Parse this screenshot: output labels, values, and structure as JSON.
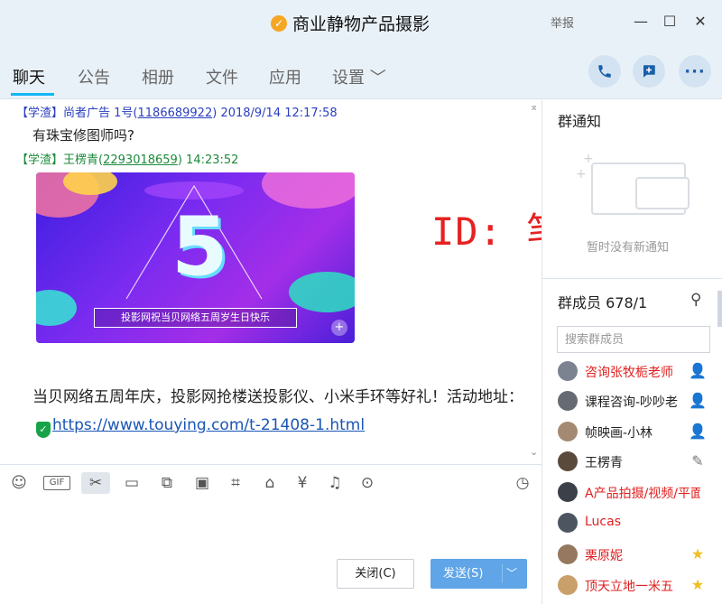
{
  "window": {
    "title": "商业静物产品摄影",
    "report_label": "举报",
    "minimize_icon": "minimize-icon",
    "maximize_icon": "maximize-icon",
    "close_icon": "close-icon"
  },
  "tabs": [
    {
      "label": "聊天"
    },
    {
      "label": "公告"
    },
    {
      "label": "相册"
    },
    {
      "label": "文件"
    },
    {
      "label": "应用"
    },
    {
      "label": "设置 ﹀"
    }
  ],
  "chat": {
    "msg1": {
      "tag": "【学渣】",
      "sender": "尚者广告 1号",
      "qq": "1186689922",
      "time": "2018/9/14 12:17:58",
      "text": "有珠宝修图师吗?"
    },
    "msg2": {
      "tag": "【学渣】",
      "sender": "王楞青",
      "qq": "2293018659",
      "time": "14:23:52"
    },
    "banner_caption": "投影网祝当贝网络五周岁生日快乐",
    "banner_number": "5",
    "body_text": "当贝网络五周年庆，投影网抢楼送投影仪、小米手环等好礼！活动地址：",
    "body_link": "https://www.touying.com/t-21408-1.html",
    "watermark": "ID: 笔中求生"
  },
  "toolbar": {
    "icons": [
      "emoji-icon",
      "gif-icon",
      "scissors-icon",
      "folder-icon",
      "screenshot-icon",
      "image-icon",
      "game-icon",
      "gift-icon",
      "red-packet-icon",
      "bell-icon",
      "more-icon",
      "history-icon"
    ]
  },
  "composer": {
    "close_label": "关闭(C)",
    "send_label": "发送(S)"
  },
  "notice": {
    "title": "群通知",
    "empty_text": "暂时没有新通知"
  },
  "members": {
    "title": "群成员 678/1",
    "search_placeholder": "搜索群成员",
    "list": [
      {
        "name": "咨询张牧栀老师",
        "color": "#e02020",
        "role": "admin-icon"
      },
      {
        "name": "课程咨询-吵吵老",
        "color": "#222222",
        "role": "admin-icon"
      },
      {
        "name": "帧映画-小林",
        "color": "#222222",
        "role": "admin-icon"
      },
      {
        "name": "王楞青",
        "color": "#222222",
        "role": "edit-icon"
      },
      {
        "name": "A产品拍摄/视频/平面",
        "color": "#e02020",
        "role": ""
      },
      {
        "name": "Lucas",
        "color": "#e02020",
        "role": ""
      },
      {
        "name": "栗原妮",
        "color": "#e02020",
        "role": "star-icon"
      },
      {
        "name": "顶天立地一米五",
        "color": "#e02020",
        "role": "star-icon"
      }
    ]
  }
}
